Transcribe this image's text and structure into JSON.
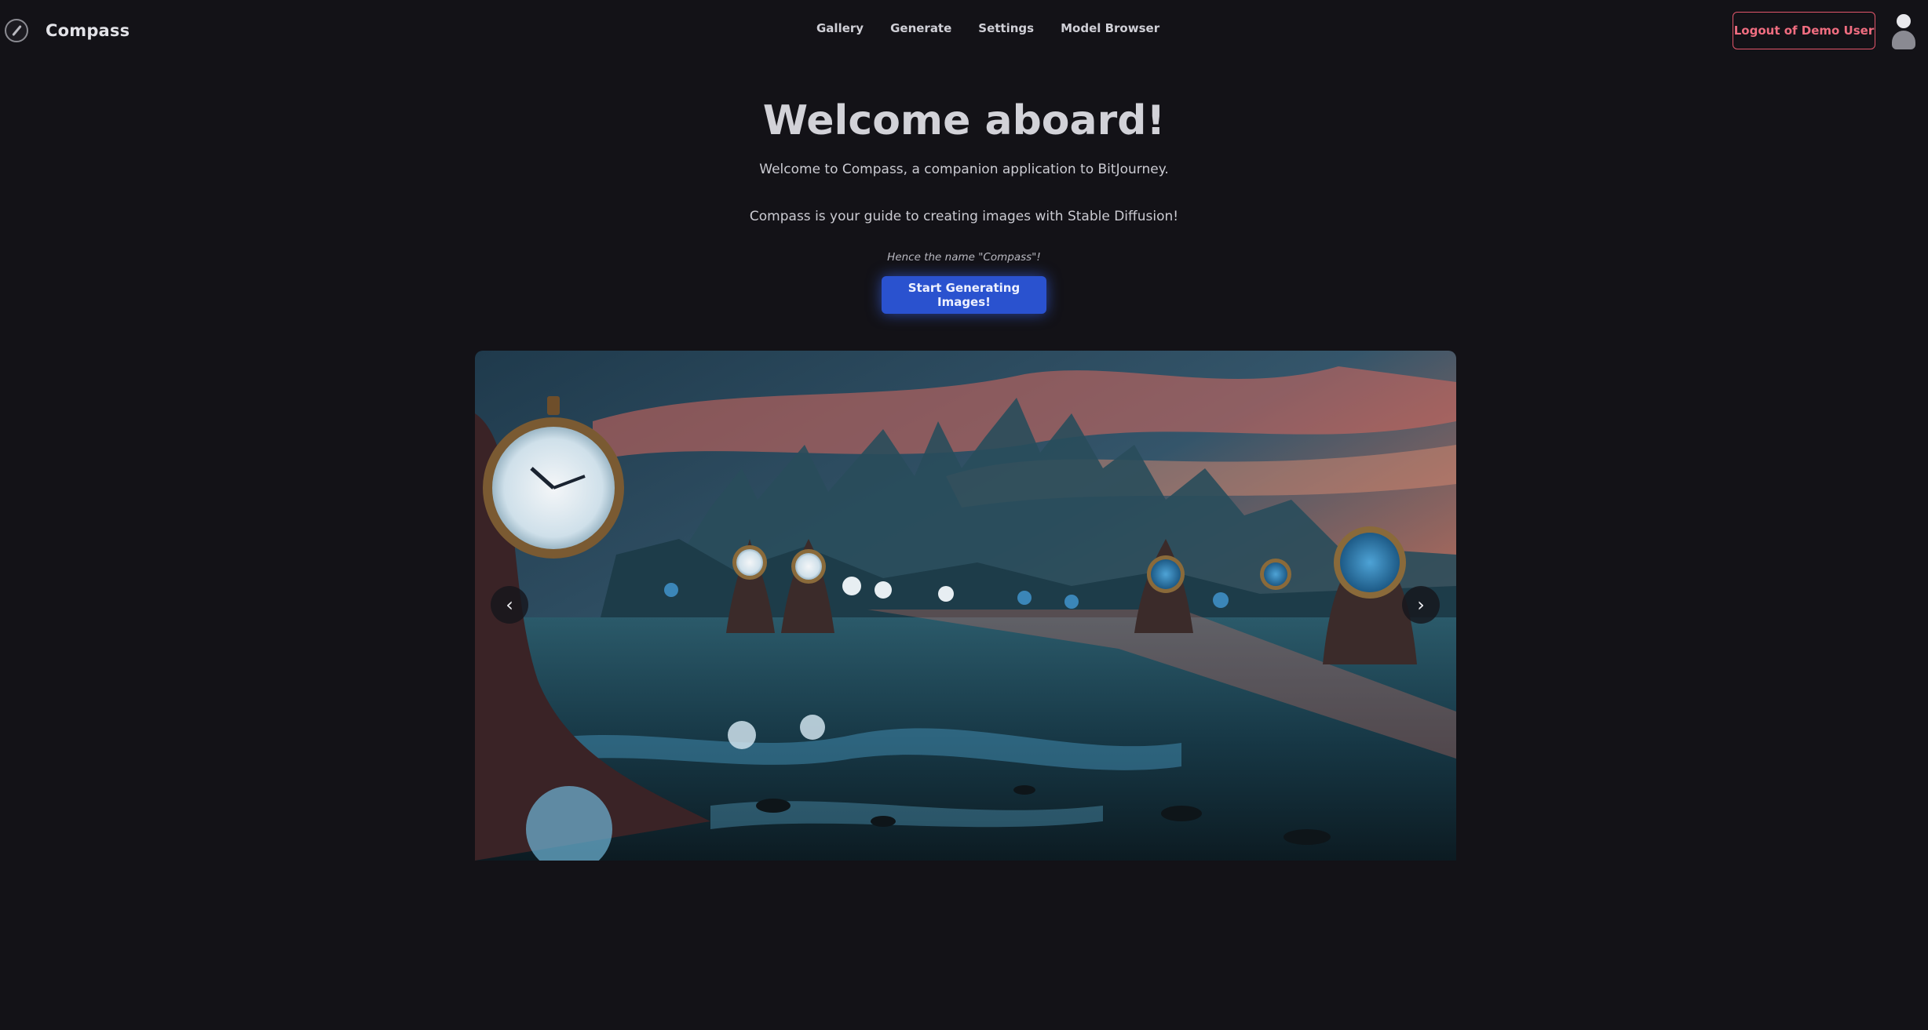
{
  "header": {
    "brand_name": "Compass",
    "nav": [
      "Gallery",
      "Generate",
      "Settings",
      "Model Browser"
    ],
    "logout_label": "Logout of Demo User"
  },
  "hero": {
    "title": "Welcome aboard!",
    "intro": "Welcome to Compass, a companion application to BitJourney.",
    "description": "Compass is your guide to creating images with Stable Diffusion!",
    "tagline": "Hence the name \"Compass\"!",
    "cta_label": "Start Generating Images!"
  },
  "carousel": {
    "prev_label": "‹",
    "next_label": "›"
  },
  "colors": {
    "background": "#131217",
    "accent": "#2a52cf",
    "logout": "#e2566b"
  }
}
